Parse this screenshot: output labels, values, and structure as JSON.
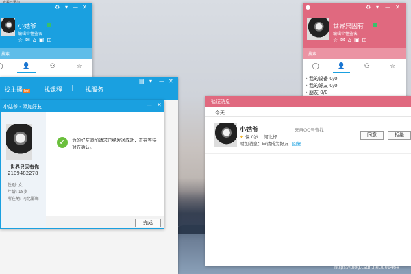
{
  "top_caption": "查看已添加",
  "qq_left": {
    "nickname": "小姑爷",
    "signature": "编辑个性签名",
    "more": "...",
    "search": "搜索"
  },
  "qq_right": {
    "nickname": "世界只因有",
    "signature": "编辑个性签名",
    "more": "...",
    "search": "搜索",
    "groups": [
      {
        "label": "我的设备",
        "count": "0/0"
      },
      {
        "label": "我的好友",
        "count": "0/0"
      },
      {
        "label": "朋友",
        "count": "0/0"
      }
    ]
  },
  "find": {
    "tab1": "找主播",
    "badge": "hot",
    "tab2": "找课程",
    "tab3": "找服务"
  },
  "add_friend": {
    "title": "小姑爷 - 添加好友",
    "name": "世界只因有你",
    "qq": "2109482278",
    "gender": "性别: 女",
    "age": "年龄: 18岁",
    "location": "所在地: 河北邯郸",
    "message": "你的好友添加请求已经发送成功，正在等待对方确认。",
    "done": "完成"
  },
  "verify": {
    "title": "验证消息",
    "today": "今天",
    "name": "小姑爷",
    "meta_gender": "保",
    "meta_age": "0岁",
    "meta_location": "河北邯",
    "source": "来自QQ号查找",
    "note_label": "附加消息：",
    "note": "申请成为好友",
    "reply": "回复",
    "agree": "同意",
    "reject": "拒绝"
  },
  "watermark": "https://blog.csdn.net/u01464"
}
